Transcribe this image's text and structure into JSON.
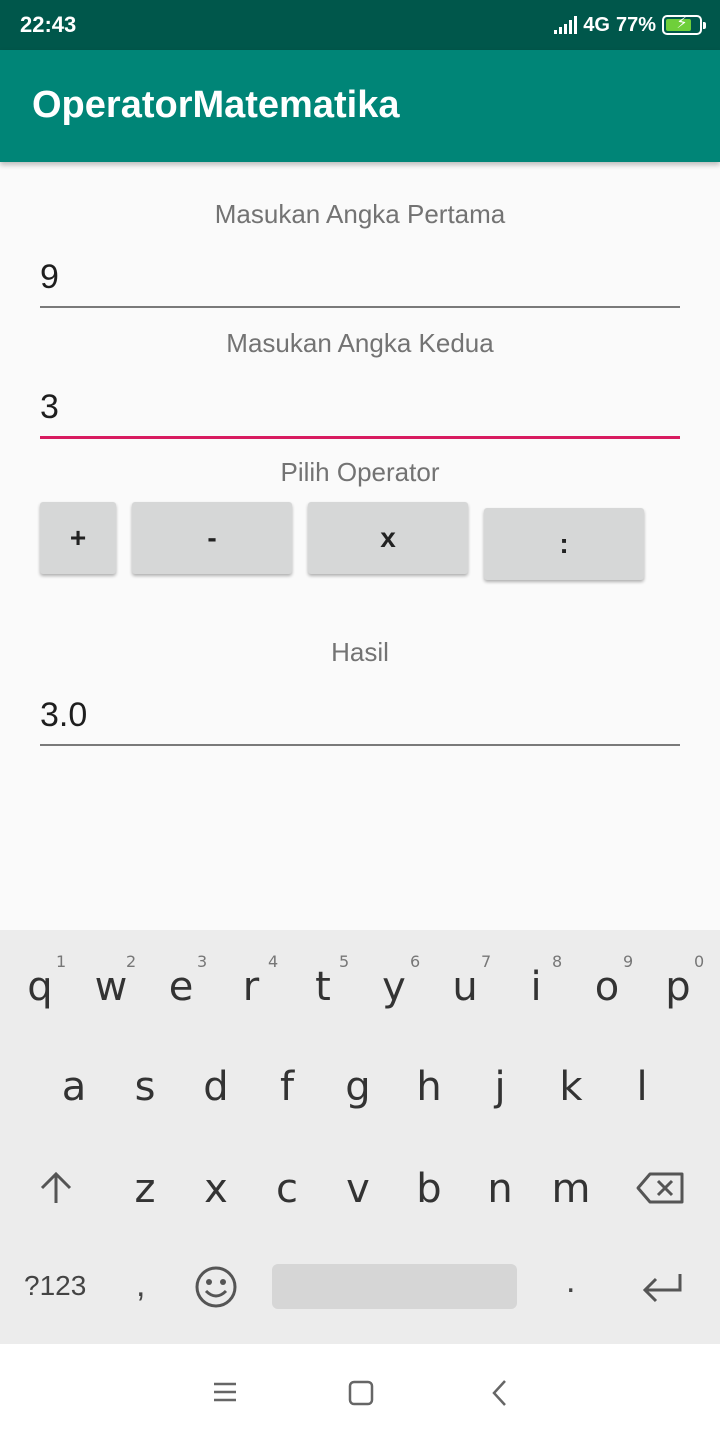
{
  "status_bar": {
    "time": "22:43",
    "network": "4G",
    "battery": "77%",
    "battery_level": 0.77
  },
  "app_bar": {
    "title": "OperatorMatematika"
  },
  "form": {
    "first_label": "Masukan Angka Pertama",
    "first_value": "9",
    "second_label": "Masukan Angka Kedua",
    "second_value": "3",
    "operator_label": "Pilih Operator",
    "operators": [
      "+",
      "-",
      "x",
      ":"
    ],
    "result_label": "Hasil",
    "result_value": "3.0"
  },
  "keyboard": {
    "row1": [
      "q",
      "w",
      "e",
      "r",
      "t",
      "y",
      "u",
      "i",
      "o",
      "p"
    ],
    "row1_hints": [
      "1",
      "2",
      "3",
      "4",
      "5",
      "6",
      "7",
      "8",
      "9",
      "0"
    ],
    "row2": [
      "a",
      "s",
      "d",
      "f",
      "g",
      "h",
      "j",
      "k",
      "l"
    ],
    "row3": [
      "z",
      "x",
      "c",
      "v",
      "b",
      "n",
      "m"
    ],
    "symbols_label": "?123",
    "comma": ",",
    "period": "."
  },
  "icons": {
    "shift": "shift-icon",
    "backspace": "backspace-icon",
    "emoji": "emoji-icon",
    "enter": "enter-icon",
    "menu": "menu-icon",
    "home": "home-icon",
    "back": "back-icon"
  },
  "colors": {
    "status_bar": "#00574b",
    "app_bar": "#008577",
    "accent": "#d81b60"
  }
}
